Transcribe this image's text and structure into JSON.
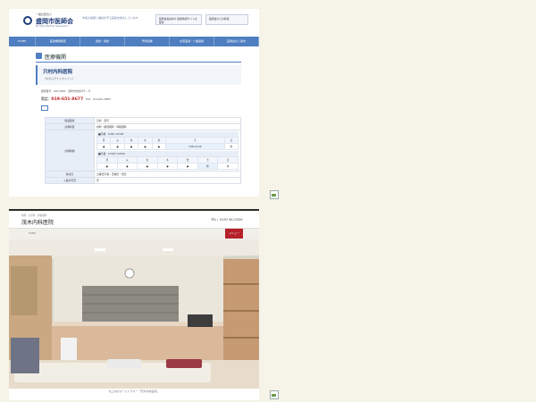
{
  "site1": {
    "logo_sub": "一般社団法人",
    "logo_main": "盛岡市医師会",
    "logo_en": "Morioka Medical Association",
    "tagline": "市民の健康と福祉を守る医療支援をしています",
    "header_links": [
      "医師会会員向け 医療情報サイトを検索",
      "医師会からの情報"
    ],
    "nav": [
      "HOME",
      "医療機関検索",
      "健診・検診",
      "予防接種",
      "在宅医療・介護連携",
      "医師会のご案内"
    ],
    "section_title": "医療機関",
    "clinic_name": "只村内科医院",
    "clinic_kana": "（タダムラナイカイイン）",
    "address": "郵便番号：020-0883　盛岡市志家町８－８",
    "tel_label": "電話：",
    "tel": "019-651-8677",
    "fax": "FAX：019-651-8683",
    "rows": [
      {
        "key": "開設医者",
        "value": "只村　武司"
      },
      {
        "key": "診療科目",
        "value": "内科・循環器科・呼吸器科"
      }
    ],
    "hours_key": "診療時間",
    "am_label": "■午前　9:00～12:00",
    "pm_label": "■午後　13:00～18:00",
    "days": [
      "月",
      "火",
      "水",
      "木",
      "金",
      "土",
      "日"
    ],
    "am_marks": [
      "●",
      "●",
      "●",
      "●",
      "●",
      "9:00-12:00",
      "休"
    ],
    "pm_marks": [
      "●",
      "●",
      "●",
      "●",
      "●",
      "休",
      "休"
    ],
    "holiday_key": "休診日",
    "holiday_value": "土曜日午後・日曜日・祝日",
    "parking_key": "入院の可否",
    "parking_value": "否"
  },
  "site2": {
    "subtitle": "内科 · 小児科 · 消化器科",
    "clinic_name": "茂木内科医院",
    "tel": "TEL：0197-61-0320",
    "nav_item": "HOME",
    "menu_button": "メニュー",
    "caption": "北上市のホームドクター「茂木内科医院」"
  },
  "colors": {
    "site1_accent": "#4f7fc0",
    "site2_accent": "#b5202a"
  }
}
